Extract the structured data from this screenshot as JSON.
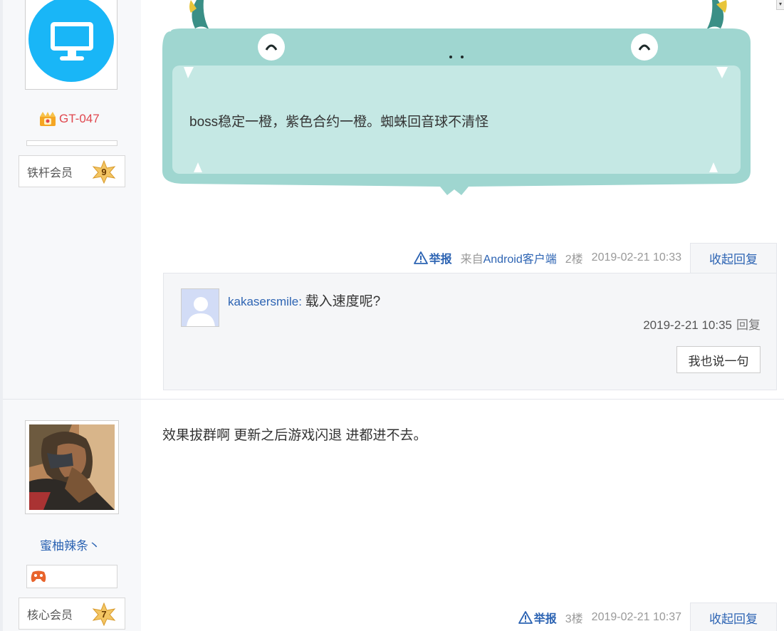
{
  "post1": {
    "username": "GT-047",
    "level_title": "铁杆会员",
    "level_num": "9",
    "content": "boss稳定一橙，紫色合约一橙。蜘蛛回音球不清怪",
    "report": "举报",
    "source_prefix": "来自",
    "source_link": "Android客户端",
    "floor": "2楼",
    "time": "2019-02-21 10:33",
    "collapse_label": "收起回复",
    "reply": {
      "user": "kakasersmile",
      "sep": ":",
      "content": "载入速度呢?",
      "time": "2019-2-21 10:35",
      "reply_label": "回复",
      "say_button": "我也说一句"
    }
  },
  "post2": {
    "username": "蜜柚辣条丶",
    "level_title": "核心会员",
    "level_num": "7",
    "content": "效果拔群啊 更新之后游戏闪退 进都进不去。",
    "report": "举报",
    "floor": "3楼",
    "time": "2019-02-21 10:37",
    "collapse_label": "收起回复"
  },
  "colors": {
    "link_blue": "#2d64b3",
    "username_red": "#e0474e",
    "bubble_teal": "#9fd6d0",
    "bubble_inner": "#c5e8e4",
    "avatar_blue": "#19b6f7"
  },
  "icons": [
    "computer-icon",
    "crown-icon",
    "star-badge-icon",
    "warning-icon",
    "default-avatar-icon",
    "gamepad-badge-icon"
  ]
}
